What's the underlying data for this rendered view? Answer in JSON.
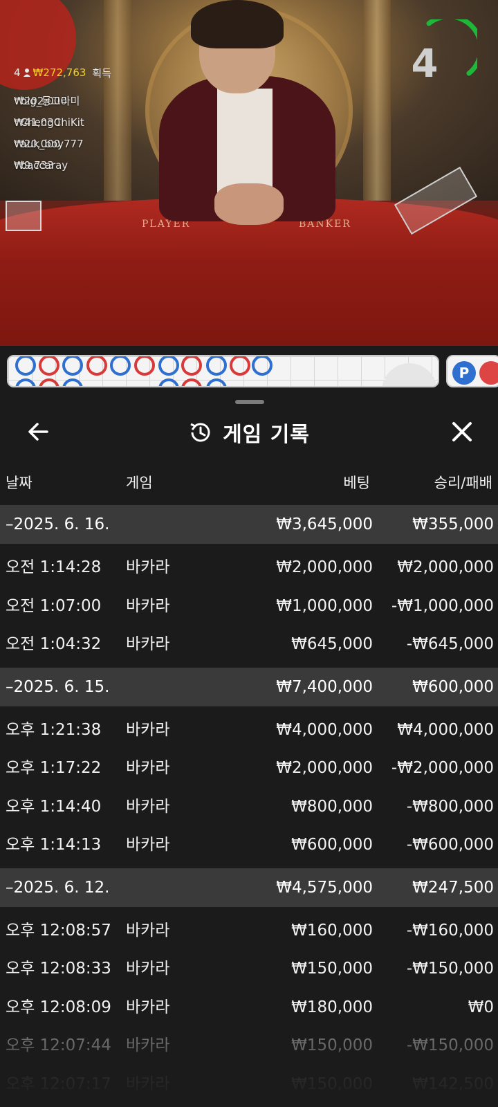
{
  "stream": {
    "leaderboard": {
      "count": "4",
      "total": "₩272,763",
      "suffix": "획득",
      "entries": [
        {
          "amount": "₩202,000",
          "user": "big_동그라미"
        },
        {
          "amount": "₩41,030",
          "user": "ChengChiKit"
        },
        {
          "amount": "₩20,000",
          "user": "auk_boy777"
        },
        {
          "amount": "₩9,733",
          "user": "baccaray"
        }
      ]
    },
    "countdown": "4",
    "countdown_color": "#1db83a",
    "table_labels": {
      "player": "PLAYER",
      "banker": "BANKER"
    }
  },
  "roadmap": {
    "beads_top": [
      "blue",
      "red",
      "blue",
      "red-slash",
      "blue",
      "red",
      "blue",
      "red",
      "blue",
      "red",
      "blue"
    ],
    "side_label": "P",
    "player_color": "#2f6fd0",
    "banker_color": "#d83a3a"
  },
  "history": {
    "title": "게임 기록",
    "back_icon": "arrow-left-icon",
    "history_icon": "history-clock-icon",
    "close_icon": "close-icon",
    "columns": {
      "date": "날짜",
      "game": "게임",
      "bet": "베팅",
      "result": "승리/패배"
    },
    "groups": [
      {
        "date": "–2025. 6. 16.",
        "bet": "₩3,645,000",
        "result": "₩355,000",
        "rows": [
          {
            "time": "오전 1:14:28",
            "game": "바카라",
            "bet": "₩2,000,000",
            "result": "₩2,000,000"
          },
          {
            "time": "오전 1:07:00",
            "game": "바카라",
            "bet": "₩1,000,000",
            "result": "-₩1,000,000"
          },
          {
            "time": "오전 1:04:32",
            "game": "바카라",
            "bet": "₩645,000",
            "result": "-₩645,000"
          }
        ]
      },
      {
        "date": "–2025. 6. 15.",
        "bet": "₩7,400,000",
        "result": "₩600,000",
        "rows": [
          {
            "time": "오후 1:21:38",
            "game": "바카라",
            "bet": "₩4,000,000",
            "result": "₩4,000,000"
          },
          {
            "time": "오후 1:17:22",
            "game": "바카라",
            "bet": "₩2,000,000",
            "result": "-₩2,000,000"
          },
          {
            "time": "오후 1:14:40",
            "game": "바카라",
            "bet": "₩800,000",
            "result": "-₩800,000"
          },
          {
            "time": "오후 1:14:13",
            "game": "바카라",
            "bet": "₩600,000",
            "result": "-₩600,000"
          }
        ]
      },
      {
        "date": "–2025. 6. 12.",
        "bet": "₩4,575,000",
        "result": "₩247,500",
        "rows": [
          {
            "time": "오후 12:08:57",
            "game": "바카라",
            "bet": "₩160,000",
            "result": "-₩160,000"
          },
          {
            "time": "오후 12:08:33",
            "game": "바카라",
            "bet": "₩150,000",
            "result": "-₩150,000"
          },
          {
            "time": "오후 12:08:09",
            "game": "바카라",
            "bet": "₩180,000",
            "result": "₩0"
          },
          {
            "time": "오후 12:07:44",
            "game": "바카라",
            "bet": "₩150,000",
            "result": "-₩150,000"
          },
          {
            "time": "오후 12:07:17",
            "game": "바카라",
            "bet": "₩150,000",
            "result": "₩142,500"
          }
        ]
      }
    ]
  }
}
